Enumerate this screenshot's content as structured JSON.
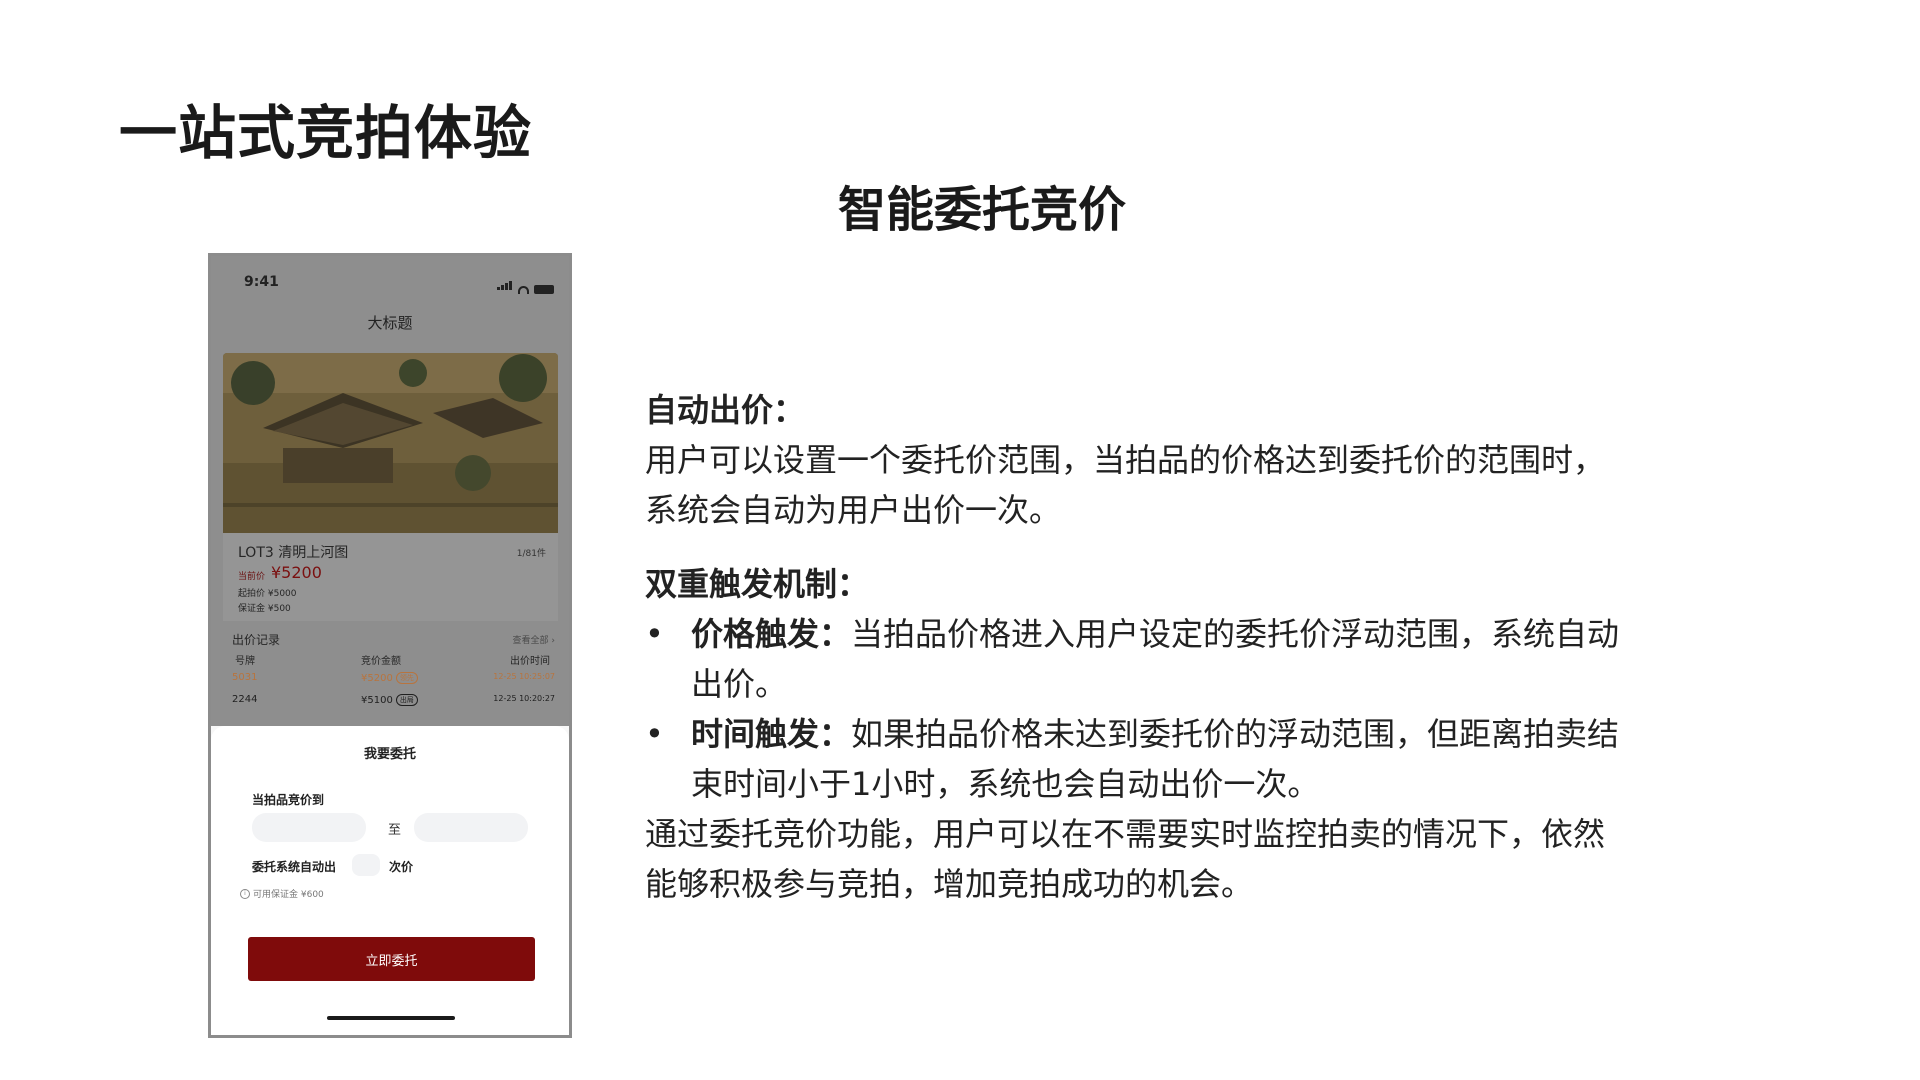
{
  "slide": {
    "title": "一站式竞拍体验",
    "subtitle": "智能委托竞价"
  },
  "phone": {
    "status_time": "9:41",
    "nav_title": "大标题",
    "lot": {
      "title": "LOT3 清明上河图",
      "count": "1/81件",
      "current_label": "当前价",
      "current_price": "¥5200",
      "start_price": "起拍价 ¥5000",
      "deposit": "保证金 ¥500"
    },
    "records": {
      "title": "出价记录",
      "more": "查看全部 ›",
      "headers": [
        "号牌",
        "竞价金额",
        "出价时间"
      ],
      "rows": [
        {
          "paddle": "5031",
          "amount": "¥5200",
          "tag": "领先",
          "time": "12-25 10:25:07"
        },
        {
          "paddle": "2244",
          "amount": "¥5100",
          "tag": "出局",
          "time": "12-25 10:20:27"
        }
      ]
    },
    "sheet": {
      "title": "我要委托",
      "price_label": "当拍品竞价到",
      "to_label": "至",
      "auto_label": "委托系统自动出",
      "times_label": "次价",
      "available": "可用保证金 ¥600",
      "submit": "立即委托"
    },
    "colors": {
      "accent": "#7f0b0b",
      "lead": "#c0622c"
    }
  },
  "content": {
    "auto_bid_title": "自动出价：",
    "auto_bid_text": "用户可以设置一个委托价范围，当拍品的价格达到委托价的范围时，系统会自动为用户出价一次。",
    "dual_title": "双重触发机制：",
    "bullet_char": "•",
    "bullets": [
      {
        "label": "价格触发：",
        "text": "当拍品价格进入用户设定的委托价浮动范围，系统自动出价。"
      },
      {
        "label": "时间触发：",
        "text": "如果拍品价格未达到委托价的浮动范围，但距离拍卖结束时间小于1小时，系统也会自动出价一次。"
      }
    ],
    "summary": "通过委托竞价功能，用户可以在不需要实时监控拍卖的情况下，依然能够积极参与竞拍，增加竞拍成功的机会。"
  }
}
